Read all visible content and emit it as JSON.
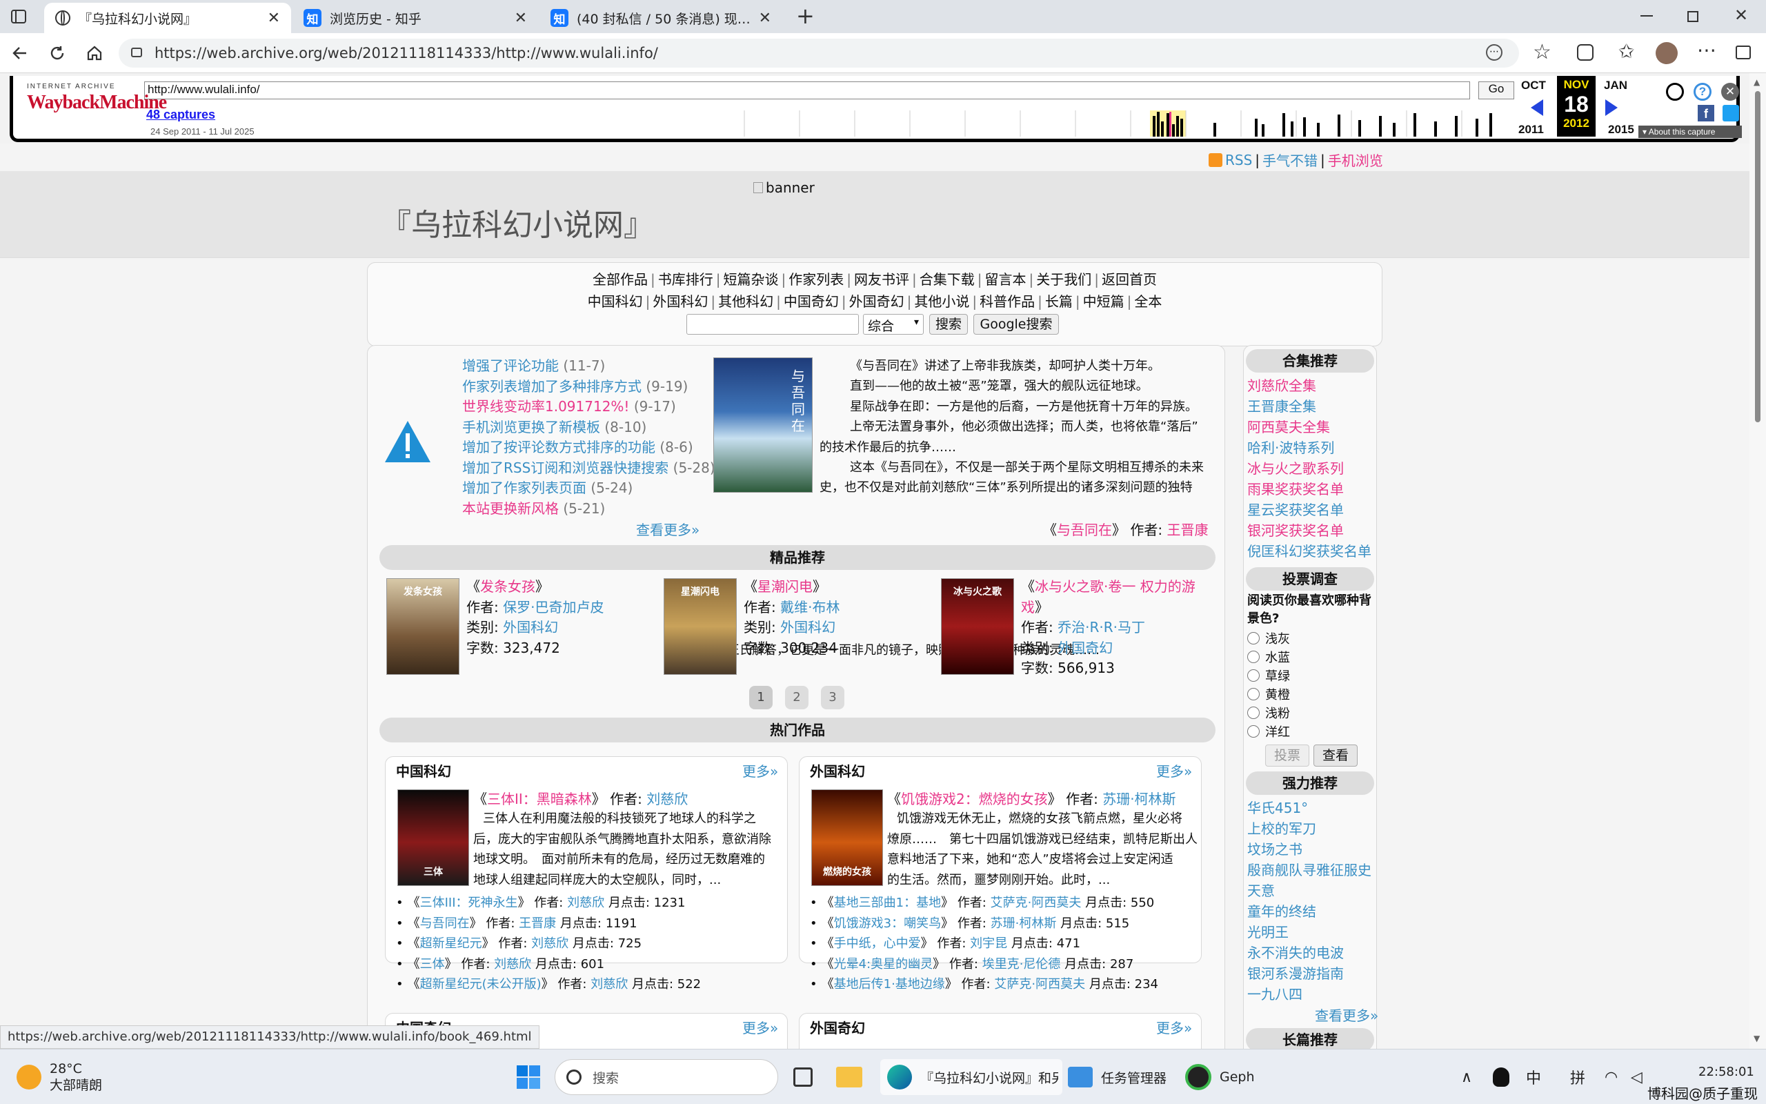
{
  "browser": {
    "tabs": [
      {
        "title": "『乌拉科幻小说网』",
        "active": true
      },
      {
        "title": "浏览历史 - 知乎",
        "active": false
      },
      {
        "title": "(40 封私信 / 50 条消息) 现在的互联",
        "active": false
      }
    ],
    "url": "https://web.archive.org/web/20121118114333/http://www.wulali.info/"
  },
  "wayback": {
    "logo_top": "INTERNET ARCHIVE",
    "logo_main": "WaybackMachine",
    "input_url": "http://www.wulali.info/",
    "go_label": "Go",
    "captures": "48 captures",
    "capture_range": "24 Sep 2011 - 11 Jul 2025",
    "prev_month": "OCT",
    "cur_month": "NOV",
    "next_month": "JAN",
    "day": "18",
    "prev_year": "2011",
    "cur_year": "2012",
    "next_year": "2015",
    "about": "About this capture"
  },
  "site": {
    "top_links": {
      "rss": "RSS",
      "lucky": "手气不错",
      "mobile": "手机浏览"
    },
    "banner_alt": "banner",
    "title": "『乌拉科幻小说网』",
    "menu_row1": [
      "全部作品",
      "书库排行",
      "短篇杂谈",
      "作家列表",
      "网友书评",
      "合集下载",
      "留言本",
      "关于我们",
      "返回首页"
    ],
    "menu_row2": [
      "中国科幻",
      "外国科幻",
      "其他科幻",
      "中国奇幻",
      "外国奇幻",
      "其他小说",
      "科普作品",
      "长篇",
      "中短篇",
      "全本"
    ],
    "search_select": "综合",
    "search_button": "搜索",
    "google_button": "Google搜索"
  },
  "news": {
    "items": [
      {
        "text": "增强了评论功能",
        "date": "(11-7)"
      },
      {
        "text": "作家列表增加了多种排序方式",
        "date": "(9-19)"
      },
      {
        "text": "世界线变动率1.091712%!",
        "date": "(9-17)"
      },
      {
        "text": "手机浏览更换了新模板",
        "date": "(8-10)"
      },
      {
        "text": "增加了按评论数方式排序的功能",
        "date": "(8-6)"
      },
      {
        "text": "增加了RSS订阅和浏览器快捷搜索",
        "date": "(5-28)"
      },
      {
        "text": "增加了作家列表页面",
        "date": "(5-24)"
      },
      {
        "text": "本站更换新风格",
        "date": "(5-21)"
      }
    ],
    "more": "查看更多»"
  },
  "feature": {
    "cover_text": "与吾同在",
    "p1": "《与吾同在》讲述了上帝非我族类，却呵护人类十万年。",
    "p2": "直到——他的故土被“恶”笼罩，强大的舰队远征地球。",
    "p3": "星际战争在即：一方是他的后裔，一方是他抚育十万年的异族。",
    "p4a": "上帝无法置身事外，他必须做出选择；而人类，也将依靠“落后”",
    "p4b": "的技术作最后的抗争……",
    "p5a": "这本《与吾同在》，不仅是一部关于两个星际文明相互搏杀的未来",
    "p5b": "史，也不仅是对此前刘慈欣“三体”系列所提出的诸多深刻问题的独特",
    "p5c": "的王氏解答，它更是一面非凡的镜子，映照出人类这个种族的灵魂……",
    "book": "与吾同在",
    "author_label": "作者:",
    "author": "王晋康"
  },
  "featured": {
    "heading": "精品推荐",
    "books": [
      {
        "title": "发条女孩",
        "author": "保罗·巴奇加卢皮",
        "category": "外国科幻",
        "words": "323,472",
        "cover": "发条女孩"
      },
      {
        "title": "星潮闪电",
        "author": "戴维·布林",
        "category": "外国科幻",
        "words": "300,234",
        "cover": "星潮闪电"
      },
      {
        "title": "冰与火之歌·卷一 权力的游戏",
        "author": "乔治·R·R·马丁",
        "category": "外国奇幻",
        "words": "566,913",
        "cover": "冰与火之歌"
      }
    ],
    "author_label": "作者:",
    "category_label": "类别:",
    "words_label": "字数:",
    "pages": [
      "1",
      "2",
      "3"
    ]
  },
  "hot": {
    "heading": "热门作品",
    "more": "更多»",
    "hits_label": "月点击:",
    "author_label": "作者:",
    "cn": {
      "title": "中国科幻",
      "lead_title": "三体II：黑暗森林",
      "lead_author": "刘慈欣",
      "cover": "三体",
      "desc1": "三体人在利用魔法般的科技锁死了地球人的科学之",
      "desc2": "后，庞大的宇宙舰队杀气腾腾地直扑太阳系，意欲消除",
      "desc3": "地球文明。　面对前所未有的危局，经历过无数磨难的",
      "desc4": "地球人组建起同样庞大的太空舰队，同时，...",
      "list": [
        {
          "title": "三体III：死神永生",
          "author": "刘慈欣",
          "hits": "1231"
        },
        {
          "title": "与吾同在",
          "author": "王晋康",
          "hits": "1191"
        },
        {
          "title": "超新星纪元",
          "author": "刘慈欣",
          "hits": "725"
        },
        {
          "title": "三体",
          "author": "刘慈欣",
          "hits": "601"
        },
        {
          "title": "超新星纪元(未公开版)",
          "author": "刘慈欣",
          "hits": "522"
        }
      ]
    },
    "fr": {
      "title": "外国科幻",
      "lead_title": "饥饿游戏2：燃烧的女孩",
      "lead_author": "苏珊·柯林斯",
      "cover": "燃烧的女孩",
      "desc1": "饥饿游戏无休无止，燃烧的女孩飞箭点燃，星火必将",
      "desc2": "燎原……　第七十四届饥饿游戏已经结束，凯特尼斯出人",
      "desc3": "意料地活了下来，她和“恋人”皮塔将会过上安定闲适",
      "desc4": "的生活。然而，噩梦刚刚开始。此时，...",
      "list": [
        {
          "title": "基地三部曲1：基地",
          "author": "艾萨克·阿西莫夫",
          "hits": "550"
        },
        {
          "title": "饥饿游戏3：嘲笑鸟",
          "author": "苏珊·柯林斯",
          "hits": "515"
        },
        {
          "title": "手中纸，心中爱",
          "author": "刘宇昆",
          "hits": "471"
        },
        {
          "title": "光晕4:奥星的幽灵",
          "author": "埃里克·尼伦德",
          "hits": "287"
        },
        {
          "title": "基地后传1·基地边缘",
          "author": "艾萨克·阿西莫夫",
          "hits": "234"
        }
      ]
    },
    "cn_fantasy": "中国奇幻",
    "fr_fantasy": "外国奇幻"
  },
  "sidebar": {
    "collections_title": "合集推荐",
    "collections": [
      "刘慈欣全集",
      "王晋康全集",
      "阿西莫夫全集",
      "哈利·波特系列",
      "冰与火之歌系列",
      "雨果奖获奖名单",
      "星云奖获奖名单",
      "银河奖获奖名单",
      "倪匡科幻奖获奖名单"
    ],
    "poll_title": "投票调查",
    "poll_question": "阅读页你最喜欢哪种背景色?",
    "poll_options": [
      "浅灰",
      "水蓝",
      "草绿",
      "黄橙",
      "浅粉",
      "洋红"
    ],
    "vote_button": "投票",
    "view_button": "查看",
    "strong_title": "强力推荐",
    "strong": [
      "华氏451°",
      "上校的军刀",
      "坟场之书",
      "殷商舰队寻雅征服史",
      "天意",
      "童年的终结",
      "光明王",
      "永不消失的电波",
      "银河系漫游指南",
      "一九八四"
    ],
    "strong_more": "查看更多»",
    "long_title": "长篇推荐"
  },
  "status_url": "https://web.archive.org/web/20121118114333/http://www.wulali.info/book_469.html",
  "taskbar": {
    "temp": "28°C",
    "weather": "大部晴朗",
    "search": "搜索",
    "edge_title": "『乌拉科幻小说网』和另",
    "taskmgr": "任务管理器",
    "geph": "Geph",
    "ime1": "中",
    "ime2": "拼",
    "time": "22:58:01",
    "watermark": "博科园@质子重现"
  },
  "colors": {
    "accent_blue": "#3a8fc4",
    "accent_pink": "#e8388a",
    "wayback_red": "#c8102e",
    "wayback_yellow": "#ffe400"
  }
}
